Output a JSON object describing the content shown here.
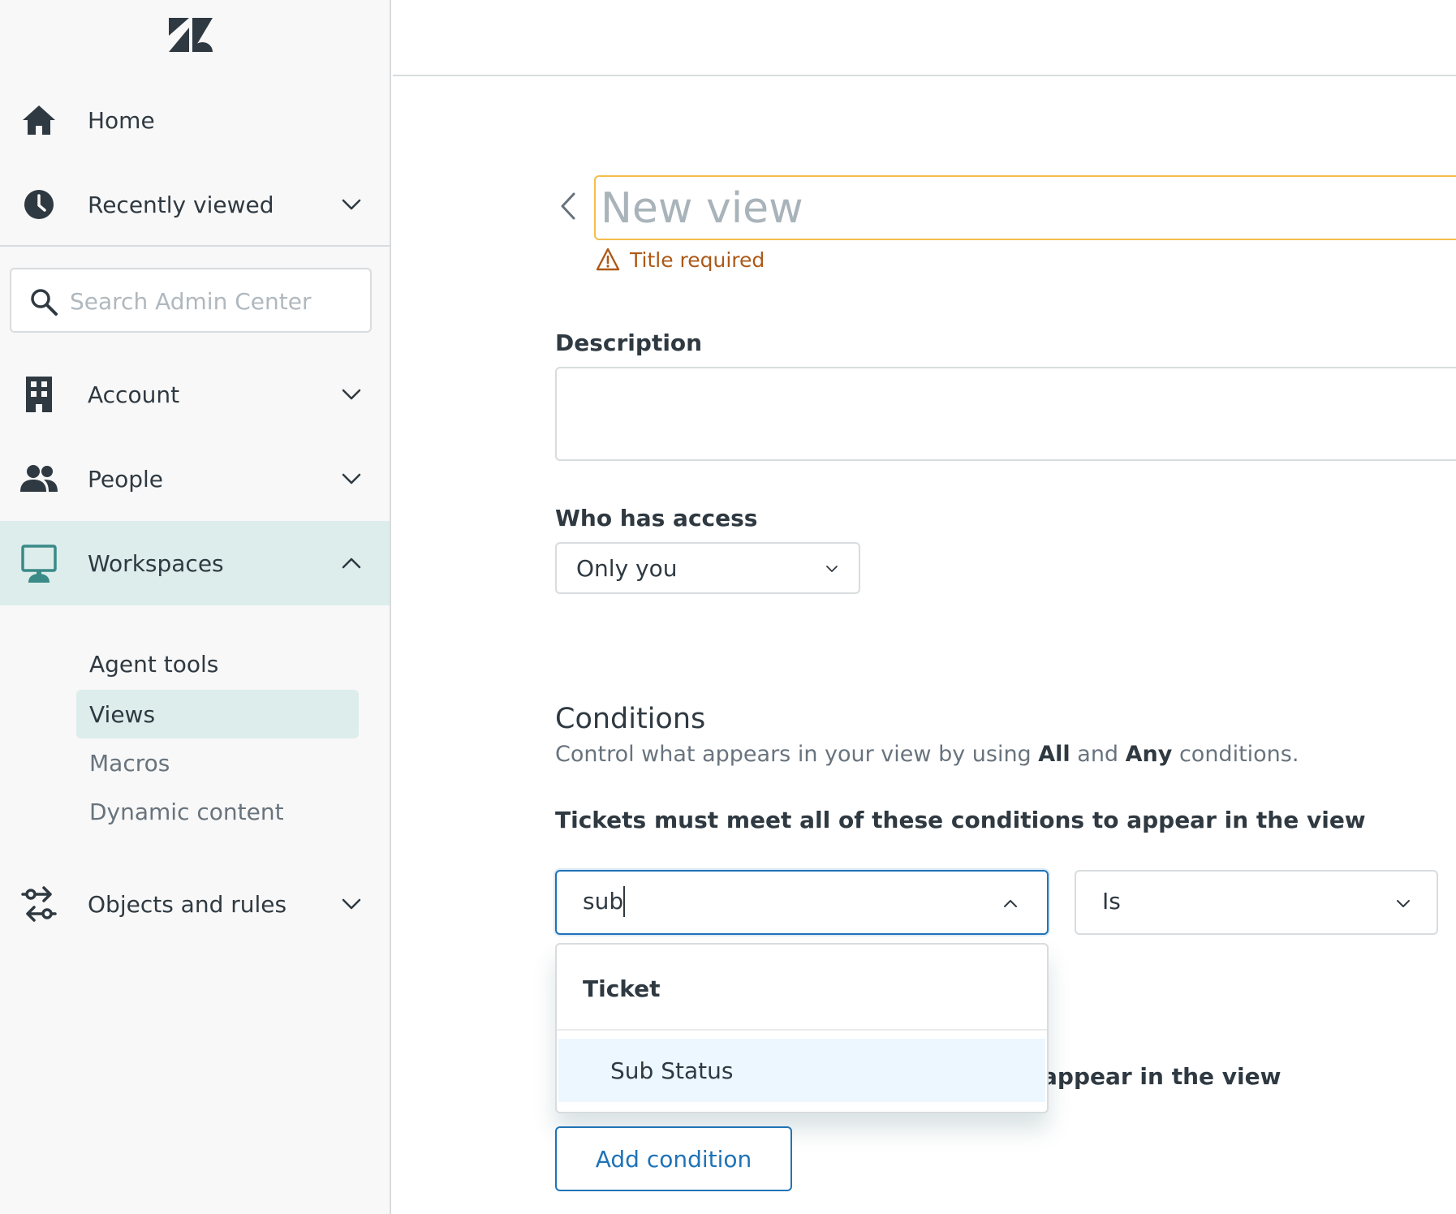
{
  "sidebar": {
    "logo": "zendesk-logo",
    "home_label": "Home",
    "recent_label": "Recently viewed",
    "search_placeholder": "Search Admin Center",
    "account_label": "Account",
    "people_label": "People",
    "workspaces_label": "Workspaces",
    "workspaces_sub": {
      "heading": "Agent tools",
      "items": [
        {
          "label": "Views",
          "selected": true
        },
        {
          "label": "Macros",
          "selected": false
        },
        {
          "label": "Dynamic content",
          "selected": false
        }
      ]
    },
    "objects_label": "Objects and rules"
  },
  "editor": {
    "title_placeholder": "New view",
    "title_value": "",
    "title_error": "Title required",
    "description_label": "Description",
    "description_value": "",
    "access_label": "Who has access",
    "access_value": "Only you"
  },
  "conditions": {
    "title": "Conditions",
    "subtitle_pre": "Control what appears in your view by using ",
    "subtitle_all": "All",
    "subtitle_mid": " and ",
    "subtitle_any": "Any",
    "subtitle_post": " conditions.",
    "all_heading": "Tickets must meet all of these conditions to appear in the view",
    "any_heading_visible": "appear in the view",
    "field_value": "sub",
    "operator_value": "Is",
    "dropdown": {
      "group": "Ticket",
      "options": [
        "Sub Status"
      ]
    },
    "add_button": "Add condition"
  },
  "colors": {
    "accent": "#1f73b7",
    "active_nav": "#dcedec",
    "warning": "#ad5918",
    "warning_border": "#f5bd4d",
    "highlight_option": "#edf7ff"
  }
}
